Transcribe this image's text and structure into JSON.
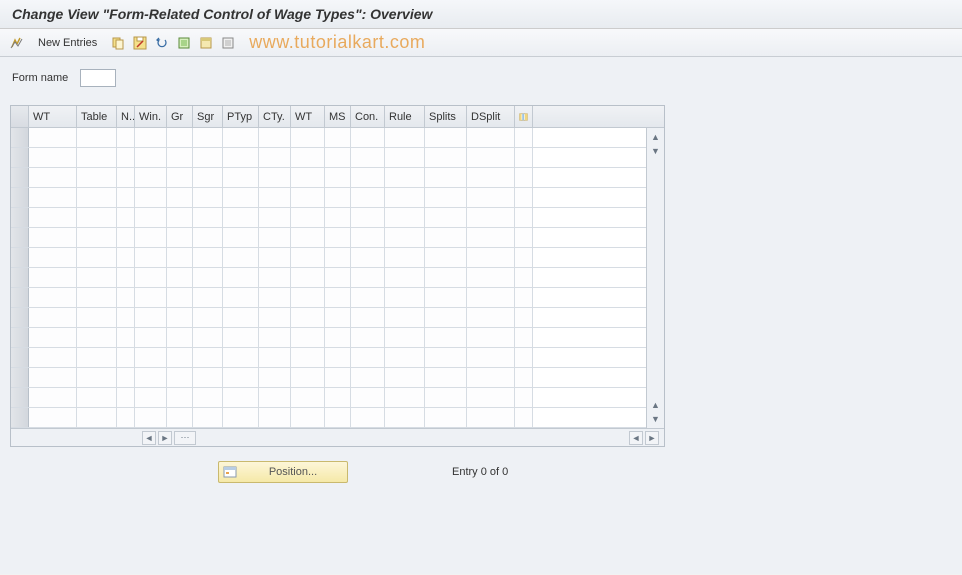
{
  "title": "Change View \"Form-Related Control of Wage Types\": Overview",
  "toolbar": {
    "new_entries": "New Entries"
  },
  "watermark": "www.tutorialkart.com",
  "form": {
    "name_label": "Form name",
    "name_value": ""
  },
  "table": {
    "columns": {
      "wt1": "WT",
      "table": "Table",
      "n": "N..",
      "win": "Win.",
      "gr": "Gr",
      "sgr": "Sgr",
      "ptyp": "PTyp",
      "cty": "CTy.",
      "wt2": "WT",
      "ms": "MS",
      "con": "Con.",
      "rule": "Rule",
      "splits": "Splits",
      "dsplit": "DSplit"
    }
  },
  "footer": {
    "position_label": "Position...",
    "entry_status": "Entry 0 of 0"
  }
}
